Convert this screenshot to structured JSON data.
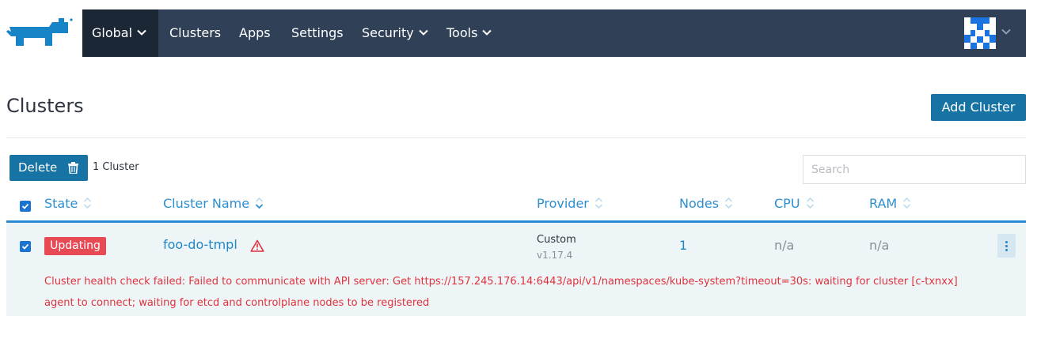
{
  "nav": {
    "global_label": "Global",
    "items": [
      "Clusters",
      "Apps",
      "Settings",
      "Security",
      "Tools"
    ]
  },
  "page": {
    "title": "Clusters",
    "add_button": "Add Cluster"
  },
  "toolbar": {
    "delete_label": "Delete",
    "count": "1 Cluster",
    "search_placeholder": "Search"
  },
  "table": {
    "headers": {
      "state": "State",
      "name": "Cluster Name",
      "provider": "Provider",
      "nodes": "Nodes",
      "cpu": "CPU",
      "ram": "RAM"
    },
    "rows": [
      {
        "state": "Updating",
        "name": "foo-do-tmpl",
        "provider": "Custom",
        "version": "v1.17.4",
        "nodes": "1",
        "cpu": "n/a",
        "ram": "n/a",
        "error": "Cluster health check failed: Failed to communicate with API server: Get https://157.245.176.14:6443/api/v1/namespaces/kube-system?timeout=30s: waiting for cluster [c-txnxx] agent to connect; waiting for etcd and controlplane nodes to be registered"
      }
    ]
  },
  "colors": {
    "navbar": "#304157",
    "nav_active": "#1c2735",
    "primary": "#1673a4",
    "link": "#1f86c7",
    "state_updating": "#e84a55",
    "error_text": "#e0323e"
  },
  "icons": [
    "rancher-logo",
    "chevron-down-icon",
    "avatar-icon",
    "trash-icon",
    "sort-icon",
    "warning-icon",
    "kebab-menu-icon",
    "checkbox-checked-icon"
  ]
}
